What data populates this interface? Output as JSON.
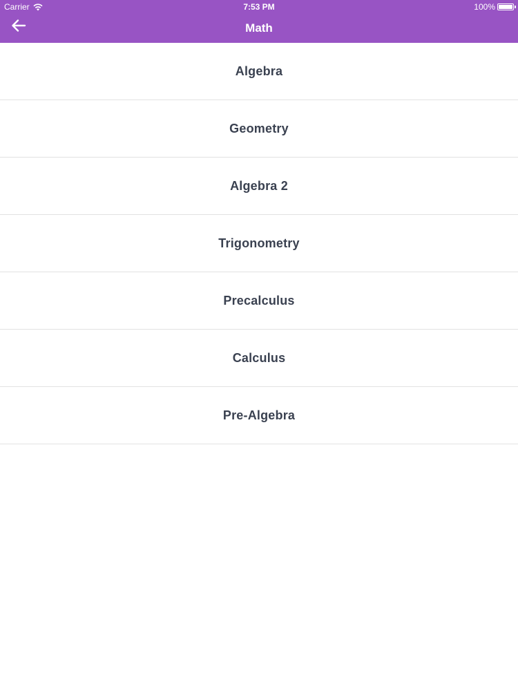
{
  "status_bar": {
    "carrier": "Carrier",
    "time": "7:53 PM",
    "battery_text": "100%",
    "battery_level": 1.0
  },
  "nav": {
    "title": "Math",
    "back_icon": "arrow-left-icon"
  },
  "colors": {
    "header_bg": "#9854c4",
    "item_text": "#3a4150",
    "divider": "#e2e2e2"
  },
  "subjects": [
    {
      "label": "Algebra"
    },
    {
      "label": "Geometry"
    },
    {
      "label": "Algebra 2"
    },
    {
      "label": "Trigonometry"
    },
    {
      "label": "Precalculus"
    },
    {
      "label": "Calculus"
    },
    {
      "label": "Pre-Algebra"
    }
  ]
}
